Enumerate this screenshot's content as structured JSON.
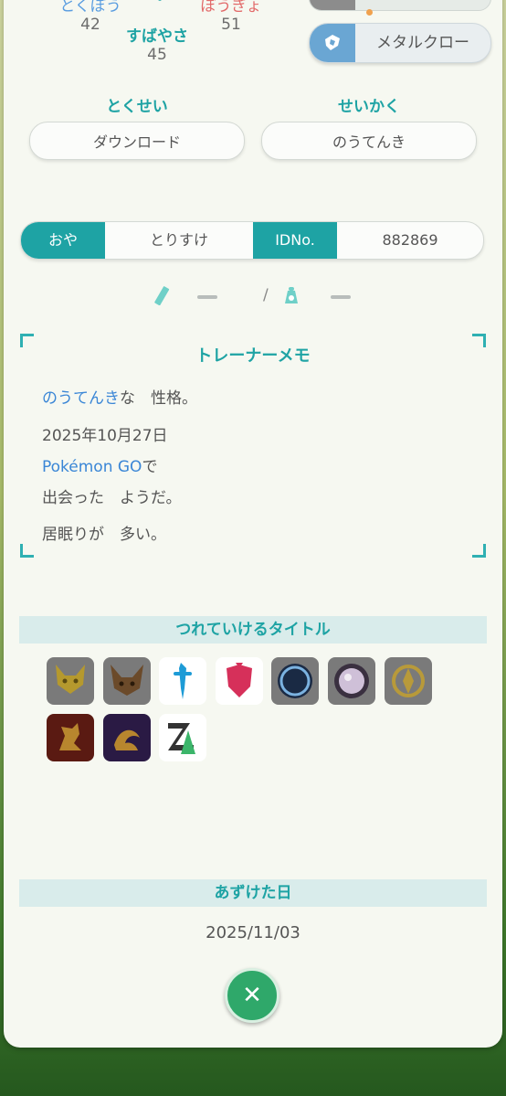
{
  "stats": {
    "left": {
      "label": "とくぼう",
      "value": "42"
    },
    "center": {
      "label": "すばやさ",
      "value": "45"
    },
    "right": {
      "label": "ぼうぎょ",
      "value": "51"
    }
  },
  "move": {
    "name": "メタルクロー"
  },
  "ability": {
    "title": "とくせい",
    "value": "ダウンロード"
  },
  "nature": {
    "title": "せいかく",
    "value": "のうてんき"
  },
  "trainer": {
    "ot_label": "おや",
    "ot_value": "とりすけ",
    "id_label": "IDNo.",
    "id_value": "882869"
  },
  "measurements": {
    "height": "—",
    "separator": "/",
    "weight": "—"
  },
  "memo": {
    "title": "トレーナーメモ",
    "nature_name": "のうてんき",
    "nature_suffix": "な　性格。",
    "date": "2025年10月27日",
    "game": "Pokémon GO",
    "game_suffix": "で",
    "met": "出会った　ようだ。",
    "trait": "居眠りが　多い。"
  },
  "titles_section": {
    "title": "つれていけるタイトル"
  },
  "badges": [
    {
      "icon": "pikachu-icon",
      "bg": "#7a7a7a"
    },
    {
      "icon": "eevee-icon",
      "bg": "#7a7a7a"
    },
    {
      "icon": "sword-icon",
      "bg": "#ffffff"
    },
    {
      "icon": "shield-icon",
      "bg": "#ffffff"
    },
    {
      "icon": "blue-orb-icon",
      "bg": "#7a7a7a"
    },
    {
      "icon": "pearl-orb-icon",
      "bg": "#7a7a7a"
    },
    {
      "icon": "gold-emblem-icon",
      "bg": "#7a7a7a"
    },
    {
      "icon": "dragon-red-icon",
      "bg": "#5a1a12"
    },
    {
      "icon": "dragon-purple-icon",
      "bg": "#2a1a44"
    },
    {
      "icon": "za-logo-icon",
      "bg": "#ffffff"
    }
  ],
  "deposit": {
    "title": "あずけた日",
    "date": "2025/11/03"
  },
  "colors": {
    "accent": "#1ea3a4",
    "close": "#2fa86a",
    "link": "#3a86d6"
  }
}
